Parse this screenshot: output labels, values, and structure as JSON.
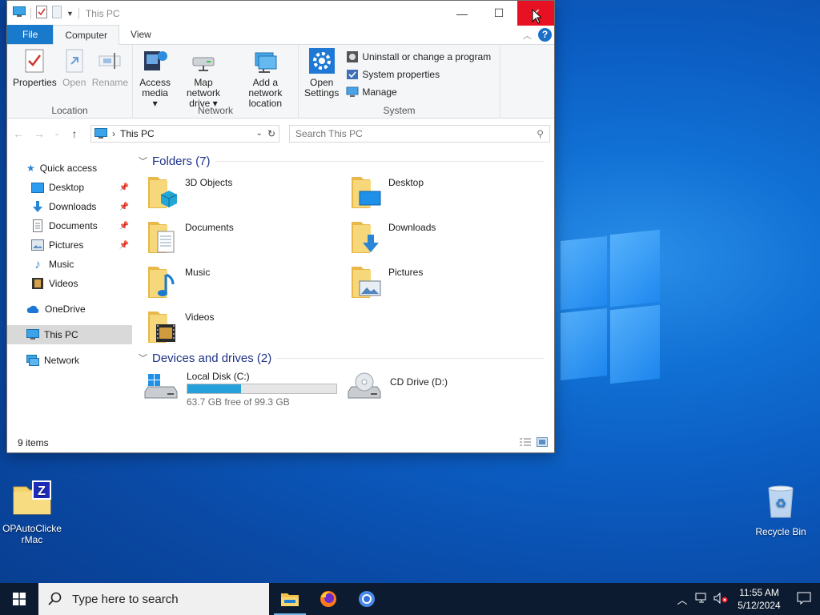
{
  "window": {
    "title": "This PC",
    "controls": {
      "minimize": "—",
      "maximize": "☐",
      "close": "✕"
    }
  },
  "ribbon": {
    "tabs": [
      {
        "label": "File"
      },
      {
        "label": "Computer"
      },
      {
        "label": "View"
      }
    ],
    "help_label": "?",
    "groups": {
      "location": {
        "label": "Location",
        "buttons": [
          {
            "label": "Properties"
          },
          {
            "label": "Open"
          },
          {
            "label": "Rename"
          }
        ]
      },
      "network": {
        "label": "Network",
        "buttons": [
          {
            "line1": "Access",
            "line2": "media ▾"
          },
          {
            "line1": "Map network",
            "line2": "drive ▾"
          },
          {
            "line1": "Add a network",
            "line2": "location"
          }
        ]
      },
      "system": {
        "label": "System",
        "open_settings": {
          "line1": "Open",
          "line2": "Settings"
        },
        "items": [
          {
            "label": "Uninstall or change a program"
          },
          {
            "label": "System properties"
          },
          {
            "label": "Manage"
          }
        ]
      }
    }
  },
  "address": {
    "crumb": "This PC",
    "search_placeholder": "Search This PC"
  },
  "nav_pane": {
    "quick_access": "Quick access",
    "quick_items": [
      {
        "label": "Desktop"
      },
      {
        "label": "Downloads"
      },
      {
        "label": "Documents"
      },
      {
        "label": "Pictures"
      },
      {
        "label": "Music"
      },
      {
        "label": "Videos"
      }
    ],
    "onedrive": "OneDrive",
    "this_pc": "This PC",
    "network": "Network"
  },
  "content": {
    "folders_header": "Folders (7)",
    "folders": [
      {
        "name": "3D Objects"
      },
      {
        "name": "Desktop"
      },
      {
        "name": "Documents"
      },
      {
        "name": "Downloads"
      },
      {
        "name": "Music"
      },
      {
        "name": "Pictures"
      },
      {
        "name": "Videos"
      }
    ],
    "devices_header": "Devices and drives (2)",
    "drives": [
      {
        "name": "Local Disk (C:)",
        "free_text": "63.7 GB free of 99.3 GB",
        "used_fraction": 0.36
      },
      {
        "name": "CD Drive (D:)"
      }
    ]
  },
  "status_bar": {
    "item_count": "9 items"
  },
  "desktop": {
    "icons": [
      {
        "line1": "OPAutoClicke",
        "line2": "rMac"
      },
      {
        "line1": "Recycle Bin",
        "line2": ""
      }
    ]
  },
  "taskbar": {
    "search_placeholder": "Type here to search",
    "time": "11:55 AM",
    "date": "5/12/2024"
  },
  "colors": {
    "accent": "#1979ca",
    "close_red": "#e81123",
    "progress": "#26a0da",
    "taskbar": "#0c1b30"
  }
}
